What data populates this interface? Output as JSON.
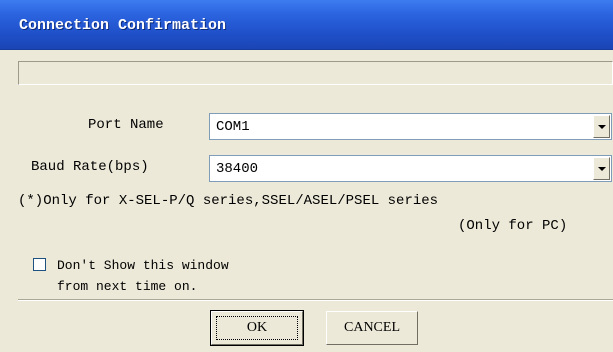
{
  "window": {
    "title": "Connection Confirmation"
  },
  "status_text": "",
  "form": {
    "port_label": "Port Name",
    "port_value": "COM1",
    "baud_label": "Baud Rate(bps)",
    "baud_value": "38400"
  },
  "note": {
    "line1": "(*)Only for X-SEL-P/Q series,SSEL/ASEL/PSEL series",
    "line2": "(Only for PC)"
  },
  "checkbox": {
    "checked": false,
    "label_line1": "Don't Show this window",
    "label_line2": "from next time on."
  },
  "buttons": {
    "ok_label": "OK",
    "cancel_label": "CANCEL"
  },
  "colors": {
    "titlebar": "#2b63df",
    "dialog_bg": "#ece9d8",
    "field_border": "#7f9db9"
  }
}
